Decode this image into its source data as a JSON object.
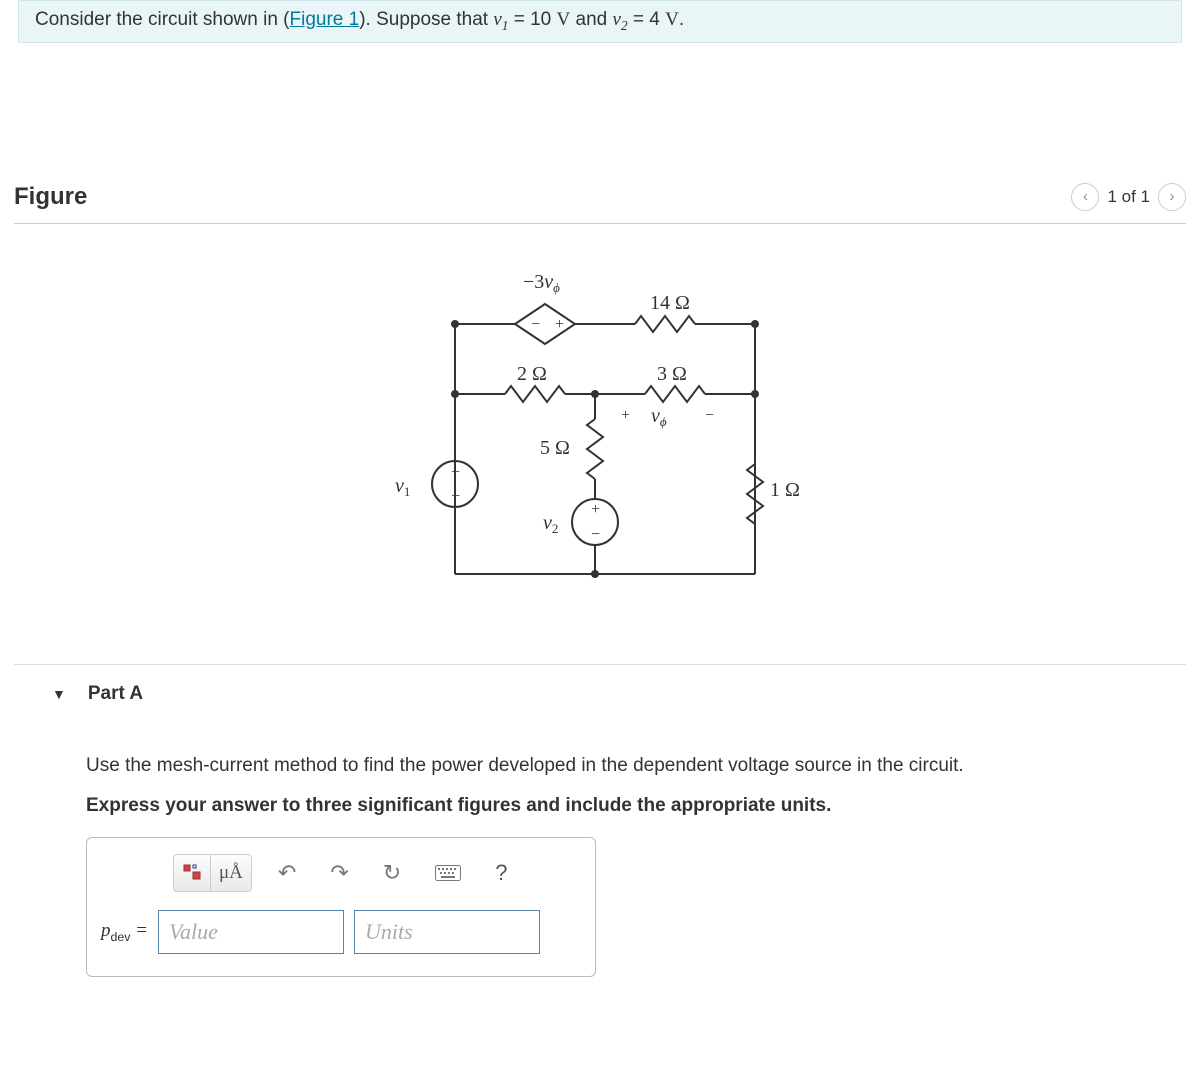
{
  "prompt": {
    "pre": "Consider the circuit shown in (",
    "link": "Figure 1",
    "post1": "). Suppose that ",
    "v1sym": "v",
    "v1sub": "1",
    "eq1": " = 10 ",
    "unitV1": "V",
    "and": " and ",
    "v2sym": "v",
    "v2sub": "2",
    "eq2": " = 4 ",
    "unitV2": "V",
    "end": "."
  },
  "figure": {
    "heading": "Figure",
    "pager": "1 of 1",
    "labels": {
      "dep_src": "−3v",
      "dep_sub": "ϕ",
      "r14": "14 Ω",
      "r2": "2 Ω",
      "r3": "3 Ω",
      "r5": "5 Ω",
      "r1": "1 Ω",
      "v1": "v",
      "v1sub": "1",
      "v2": "v",
      "v2sub": "2",
      "vphi": "v",
      "vphi_sub": "ϕ"
    }
  },
  "partA": {
    "title": "Part A",
    "instr": "Use the mesh-current method to find the power developed in the dependent voltage source in the circuit.",
    "instr2": "Express your answer to three significant figures and include the appropriate units.",
    "eq_label_main": "p",
    "eq_label_sub": "dev",
    "eq_label_post": " =",
    "value_ph": "Value",
    "units_ph": "Units",
    "toolbar": {
      "templates": "templates-icon",
      "units_btn": "μÅ",
      "undo": "↶",
      "redo": "↷",
      "reset": "↻",
      "keyboard": "⌨",
      "help": "?"
    }
  }
}
